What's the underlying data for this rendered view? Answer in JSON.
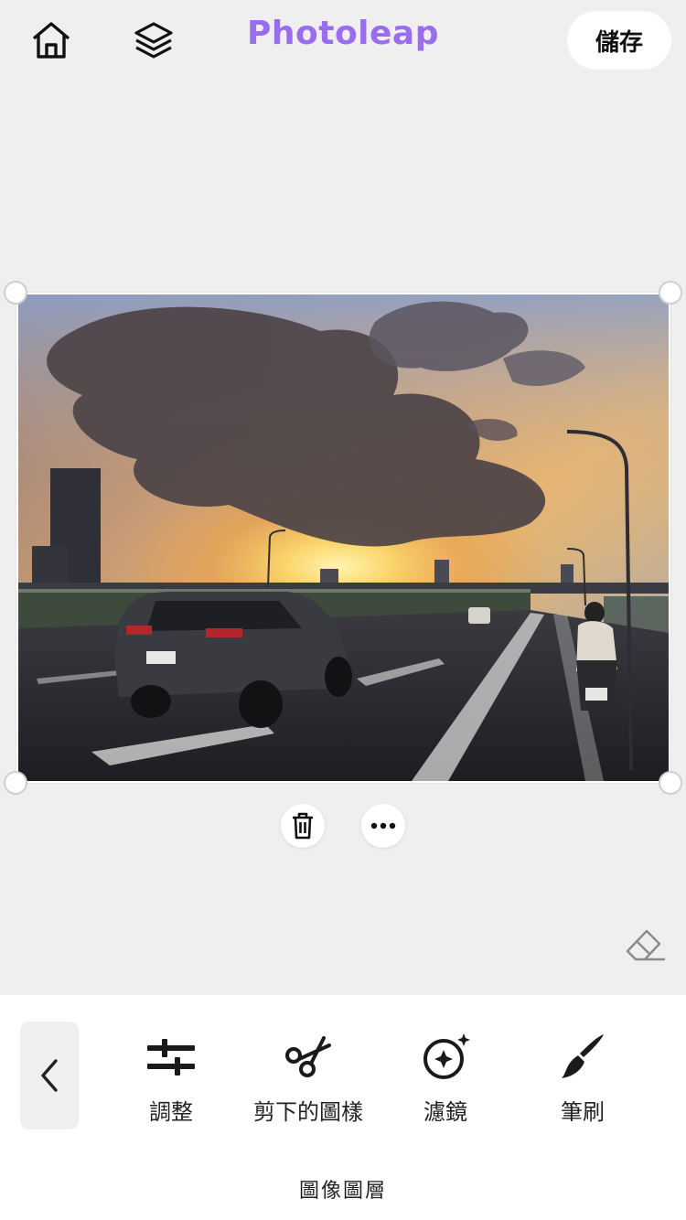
{
  "header": {
    "brand": "Photoleap",
    "save_label": "儲存",
    "home_icon": "home-icon",
    "layers_icon": "layers-icon"
  },
  "canvas": {
    "image_description_icon": "photo-layer",
    "actions": {
      "delete_icon": "trash-icon",
      "more_icon": "more-icon",
      "eraser_icon": "eraser-icon"
    }
  },
  "toolbar": {
    "back_icon": "chevron-left-icon",
    "tools": [
      {
        "label": "調整",
        "icon": "sliders-icon"
      },
      {
        "label": "剪下的圖樣",
        "icon": "scissors-icon"
      },
      {
        "label": "濾鏡",
        "icon": "filter-sparkle-icon"
      },
      {
        "label": "筆刷",
        "icon": "brush-icon"
      }
    ],
    "section_label": "圖像圖層"
  },
  "colors": {
    "brand": "#9a6cf0",
    "background": "#efefef",
    "panel": "#ffffff"
  }
}
